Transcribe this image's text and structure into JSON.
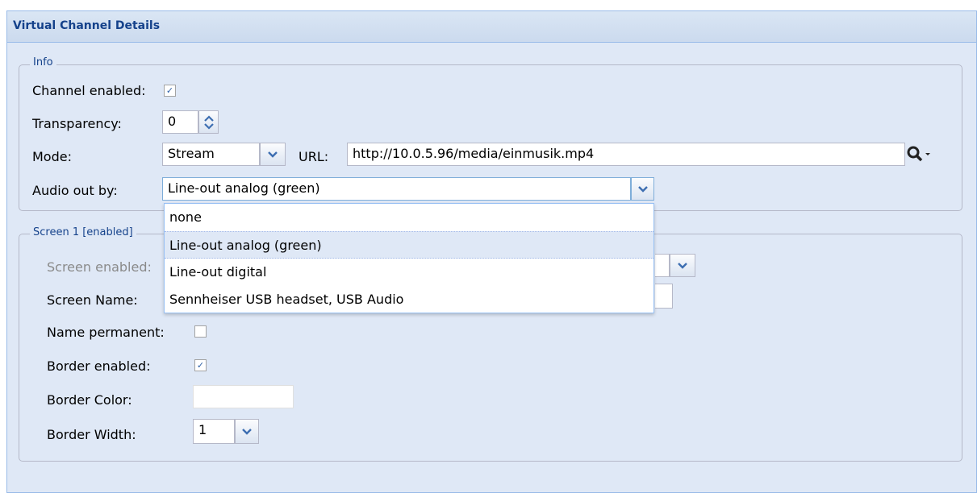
{
  "panel": {
    "title": "Virtual Channel Details"
  },
  "info": {
    "legend": "Info",
    "channel_enabled_label": "Channel enabled:",
    "channel_enabled_mark": "✓",
    "transparency_label": "Transparency:",
    "transparency_value": "0",
    "mode_label": "Mode:",
    "mode_value": "Stream",
    "url_label": "URL:",
    "url_value": "http://10.0.5.96/media/einmusik.mp4",
    "audio_label": "Audio out by:",
    "audio_value": "Line-out analog (green)"
  },
  "audio_dropdown": {
    "options": [
      {
        "label": "none"
      },
      {
        "label": "Line-out analog (green)"
      },
      {
        "label": "Line-out digital"
      },
      {
        "label": "Sennheiser USB headset, USB Audio"
      }
    ]
  },
  "screen1": {
    "legend": "Screen 1 [enabled]",
    "screen_enabled_label": "Screen enabled:",
    "screen_name_label": "Screen Name:",
    "name_permanent_label": "Name permanent:",
    "border_enabled_label": "Border enabled:",
    "border_enabled_mark": "✓",
    "border_color_label": "Border Color:",
    "border_width_label": "Border Width:",
    "border_width_value": "1"
  },
  "colors": {
    "accent": "#15428b",
    "panel_bg": "#dfe8f6",
    "border": "#99bbe8",
    "border_color_swatch": "#ffffff"
  },
  "icons": {
    "search": "search-icon",
    "trigger": "chevron-down-icon",
    "spinner": "spinner-icon"
  }
}
